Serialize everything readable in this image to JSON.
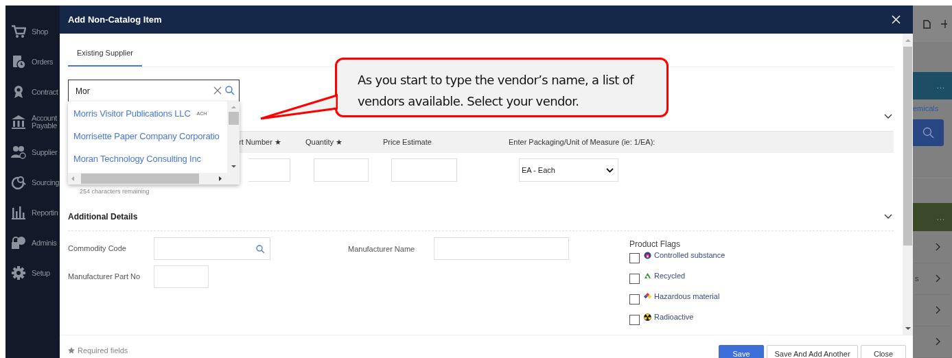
{
  "sidebar": {
    "items": [
      {
        "label": "Shop"
      },
      {
        "label": "Orders"
      },
      {
        "label": "Contract"
      },
      {
        "label": "Account Payable"
      },
      {
        "label": "Supplier"
      },
      {
        "label": "Sourcing"
      },
      {
        "label": "Reportin"
      },
      {
        "label": "Adminis"
      },
      {
        "label": "Setup"
      }
    ]
  },
  "background": {
    "menu_1": "...",
    "link_text": "emicals",
    "menu_2": "...",
    "row_text": "s"
  },
  "dialog": {
    "title": "Add Non-Catalog Item",
    "tabs": [
      {
        "label": "Existing Supplier",
        "selected": true
      }
    ],
    "supplier_search": {
      "value": "Mor",
      "suggestions": [
        {
          "name": "Morris Visitor Publications LLC",
          "tag": "ACH"
        },
        {
          "name": "Morrisette Paper Company Corporatio"
        },
        {
          "name": "Moran Technology Consulting Inc"
        }
      ]
    },
    "item_table": {
      "columns": [
        "rt Number ★",
        "Quantity ★",
        "Price Estimate",
        "Enter Packaging/Unit of Measure (ie: 1/EA):"
      ],
      "unit_value": "EA - Each"
    },
    "characters_remaining": "254 characters remaining",
    "additional_details": {
      "title": "Additional Details",
      "commodity_code": "Commodity Code",
      "manufacturer_name": "Manufacturer Name",
      "manufacturer_part_no": "Manufacturer Part No",
      "product_flags": {
        "title": "Product Flags",
        "items": [
          {
            "label": "Controlled substance",
            "checked": false
          },
          {
            "label": "Recycled",
            "checked": false
          },
          {
            "label": "Hazardous material",
            "checked": false
          },
          {
            "label": "Radioactive",
            "checked": false
          }
        ]
      }
    },
    "footer": {
      "note": "Required fields",
      "buttons": [
        "Save",
        "Save And Add Another",
        "Close"
      ]
    }
  },
  "callout": {
    "text": "As you start to type the vendor’s name, a list of vendors available. Select your vendor."
  }
}
